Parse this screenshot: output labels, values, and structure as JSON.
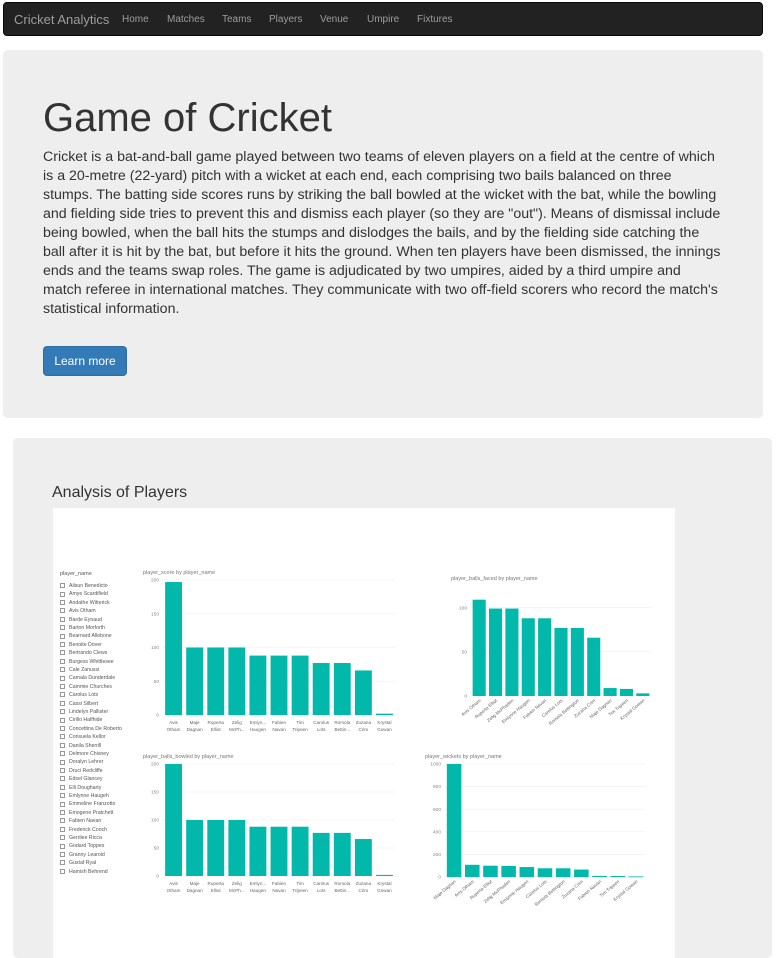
{
  "navbar": {
    "brand": "Cricket Analytics",
    "items": [
      "Home",
      "Matches",
      "Teams",
      "Players",
      "Venue",
      "Umpire",
      "Fixtures"
    ]
  },
  "jumbotron": {
    "title": "Game of Cricket",
    "body": "Cricket is a bat-and-ball game played between two teams of eleven players on a field at the centre of which is a 20-metre (22-yard) pitch with a wicket at each end, each comprising two bails balanced on three stumps. The batting side scores runs by striking the ball bowled at the wicket with the bat, while the bowling and fielding side tries to prevent this and dismiss each player (so they are \"out\"). Means of dismissal include being bowled, when the ball hits the stumps and dislodges the bails, and by the fielding side catching the ball after it is hit by the bat, but before it hits the ground. When ten players have been dismissed, the innings ends and the teams swap roles. The game is adjudicated by two umpires, aided by a third umpire and match referee in international matches. They communicate with two off-field scorers who record the match's statistical information.",
    "button_label": "Learn more"
  },
  "analysis": {
    "heading": "Analysis of Players",
    "slicer_title": "player_name",
    "players": [
      "Ailsun Benedicto",
      "Amye Scardifield",
      "Andathe Witterick",
      "Avis Otham",
      "Barde Eynaud",
      "Barton Morforth",
      "Bearnard Allebone",
      "Benoite Dover",
      "Bertrando Clews",
      "Burgess Whittlesee",
      "Cale Zanussi",
      "Camala Dunderdale",
      "Cammie Churches",
      "Carolus Lots",
      "Cassi Silbert",
      "Lindelyn Pallister",
      "Cirillo Halfhide",
      "Concettina De Roberto",
      "Consuela Kellor",
      "Danila Sherrill",
      "Delmore Chisney",
      "Doralyn Lehrer",
      "Druci Redcliffe",
      "Edsel Glancey",
      "Elli Dougharty",
      "Emlynne Haugeh",
      "Emmeline Franzotto",
      "Emogene Pratchett",
      "Fabien Navan",
      "Frederick Cooch",
      "Gerrilee Ricca",
      "Godard Toppes",
      "Granny Learoid",
      "Gustaf Ryal",
      "Hamish Behrend"
    ]
  },
  "colors": {
    "bar": "#01b8aa",
    "accent": "#337ab7",
    "nav_bg": "#222222"
  },
  "chart_data": [
    {
      "type": "bar",
      "title": "player_score by player_name",
      "categories": [
        "Avis Otham",
        "Maje Dagnan",
        "Rupertа Elliot",
        "Zelig McPh...",
        "Emlyn... Haugen",
        "Fabien Navan",
        "Tim Tripeen",
        "Carolus Lots",
        "Romola Bettin...",
        "Zuzana Crim",
        "Krystal Gowan"
      ],
      "labels": [
        "Avis|Otham",
        "Maje|Dagnan",
        "Ruperta|Elliot",
        "Zelig|McPh...",
        "Emlyn...|Haugen",
        "Fabien|Navan",
        "Tim|Tripeen",
        "Carolus|Lots",
        "Romola|Bettin...",
        "Zuzana|Crim",
        "Krystal|Gowan"
      ],
      "values": [
        197,
        100,
        100,
        100,
        88,
        88,
        88,
        77,
        77,
        66,
        2
      ],
      "ylim": [
        0,
        200
      ],
      "yticks": [
        0,
        50,
        100,
        150,
        200
      ],
      "label_style": "horizontal"
    },
    {
      "type": "bar",
      "title": "player_balls_faced by player_name",
      "labels": [
        "Avis Otham",
        "Ruperta Elliot",
        "Zelig McPhaden",
        "Emlynne Haugen",
        "Fabien Navan",
        "Carolus Lots",
        "Romola Bettington",
        "Zuzana Crim",
        "Maje Dagnan",
        "Tim Tripeen",
        "Krystal Gowan"
      ],
      "values": [
        109,
        99,
        99,
        88,
        88,
        77,
        77,
        66,
        9,
        8,
        3
      ],
      "ylim": [
        0,
        120
      ],
      "yticks": [
        0,
        50,
        100
      ],
      "label_style": "rotated"
    },
    {
      "type": "bar",
      "title": "player_balls_bowled by player_name",
      "labels": [
        "Avis|Otham",
        "Maje|Dagnan",
        "Ruperta|Elliot",
        "Zelig|McPh...",
        "Emlyn...|Haugen",
        "Fabien|Navan",
        "Tim|Tripeen",
        "Carolus|Lots",
        "Romola|Bettin...",
        "Zuzana|Crim",
        "Krystal|Gowan"
      ],
      "values": [
        200,
        100,
        100,
        100,
        88,
        88,
        88,
        77,
        77,
        66,
        2
      ],
      "ylim": [
        0,
        200
      ],
      "yticks": [
        0,
        50,
        100,
        150,
        200
      ],
      "label_style": "horizontal"
    },
    {
      "type": "bar",
      "title": "player_wickets by player_name",
      "labels": [
        "Maje Dagnan",
        "Avis Otham",
        "Ruperta Elliot",
        "Zelig McPhaden",
        "Emlynne Haugen",
        "Carolus Lots",
        "Romola Bettington",
        "Zuzana Crim",
        "Fabien Navan",
        "Tim Tripeen",
        "Krystal Gowan"
      ],
      "values": [
        1000,
        108,
        100,
        98,
        88,
        77,
        77,
        66,
        10,
        9,
        5
      ],
      "ylim": [
        0,
        1000
      ],
      "yticks": [
        0,
        200,
        400,
        600,
        800,
        1000
      ],
      "label_style": "rotated"
    }
  ]
}
